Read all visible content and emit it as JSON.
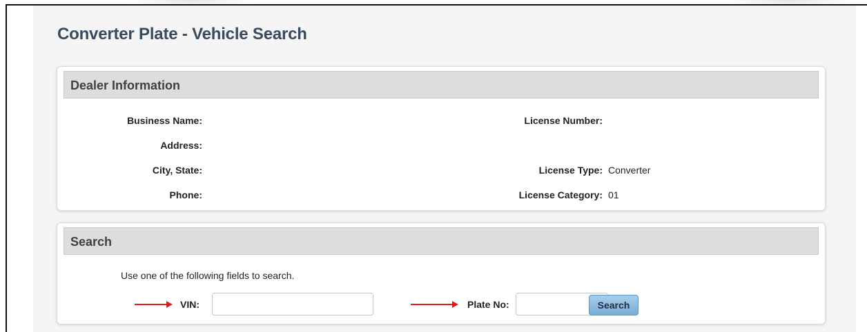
{
  "page": {
    "title": "Converter Plate - Vehicle Search"
  },
  "dealer": {
    "header": "Dealer Information",
    "business_name_label": "Business Name:",
    "address_label": "Address:",
    "city_state_label": "City, State:",
    "phone_label": "Phone:",
    "license_number_label": "License Number:",
    "license_type_label": "License Type:",
    "license_type_value": "Converter",
    "license_category_label": "License Category:",
    "license_category_value": "01"
  },
  "search": {
    "header": "Search",
    "hint": "Use one of the following fields to search.",
    "vin_label": "VIN:",
    "vin_value": "",
    "plate_label": "Plate No:",
    "plate_value": "",
    "button_label": "Search"
  },
  "colors": {
    "title": "#3a4a5c",
    "panel_header_bg": "#dddddd",
    "button_bg": "#8cbce2",
    "arrow": "#e21a1a"
  }
}
